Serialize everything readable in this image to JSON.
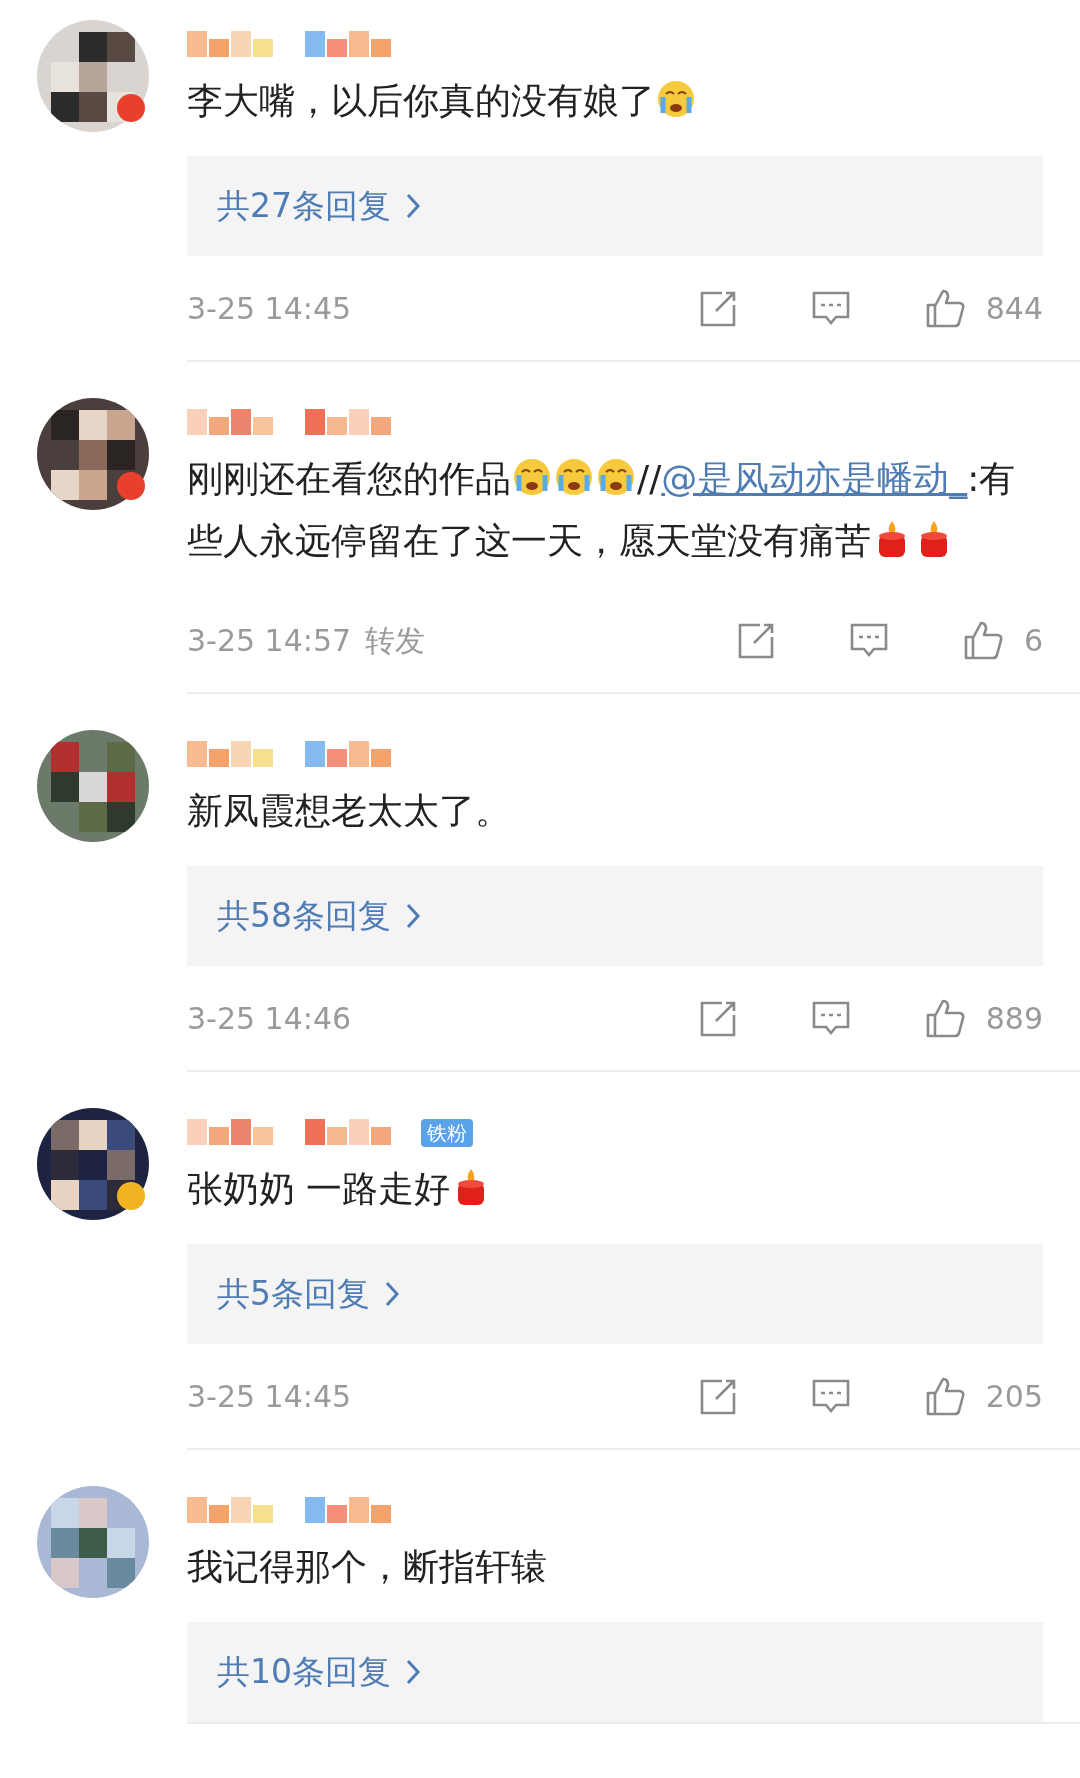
{
  "comments": [
    {
      "avatar": {
        "kind": "picture",
        "verified_badge": {
          "color": "#e8402c"
        }
      },
      "name_hidden": true,
      "content": [
        {
          "kind": "text",
          "text": "李大嘴，以后你真的没有娘了"
        },
        {
          "kind": "cry"
        }
      ],
      "replies": "共27条回复",
      "time": "3-25 14:45",
      "likes": "844"
    },
    {
      "avatar": {
        "kind": "picture",
        "verified_badge": {
          "color": "#e8402c"
        }
      },
      "name_hidden": true,
      "content": [
        {
          "kind": "text",
          "text": "刚刚还在看您的作品"
        },
        {
          "kind": "cry"
        },
        {
          "kind": "cry"
        },
        {
          "kind": "cry"
        },
        {
          "kind": "text",
          "text": "//"
        },
        {
          "kind": "link",
          "text": "@是风动亦是幡动_"
        },
        {
          "kind": "text",
          "text": ":有些人永远停留在了这一天，愿天堂没有痛苦"
        },
        {
          "kind": "candle"
        },
        {
          "kind": "candle"
        }
      ],
      "time": "3-25 14:57",
      "repost": "转发",
      "likes": "6"
    },
    {
      "avatar": {
        "kind": "picture"
      },
      "name_hidden": true,
      "content": [
        {
          "kind": "text",
          "text": "新凤霞想老太太了。"
        }
      ],
      "replies": "共58条回复",
      "time": "3-25 14:46",
      "likes": "889"
    },
    {
      "avatar": {
        "kind": "picture",
        "verified_badge": {
          "color": "#f2b322"
        }
      },
      "name_hidden": true,
      "badge": "铁粉",
      "content": [
        {
          "kind": "text",
          "text": "张奶奶 一路走好"
        },
        {
          "kind": "candle"
        }
      ],
      "replies": "共5条回复",
      "time": "3-25 14:45",
      "likes": "205"
    },
    {
      "avatar": {
        "kind": "picture"
      },
      "name_hidden": true,
      "content": [
        {
          "kind": "text",
          "text": "我记得那个，断指轩辕"
        }
      ],
      "replies": "共10条回复"
    }
  ]
}
